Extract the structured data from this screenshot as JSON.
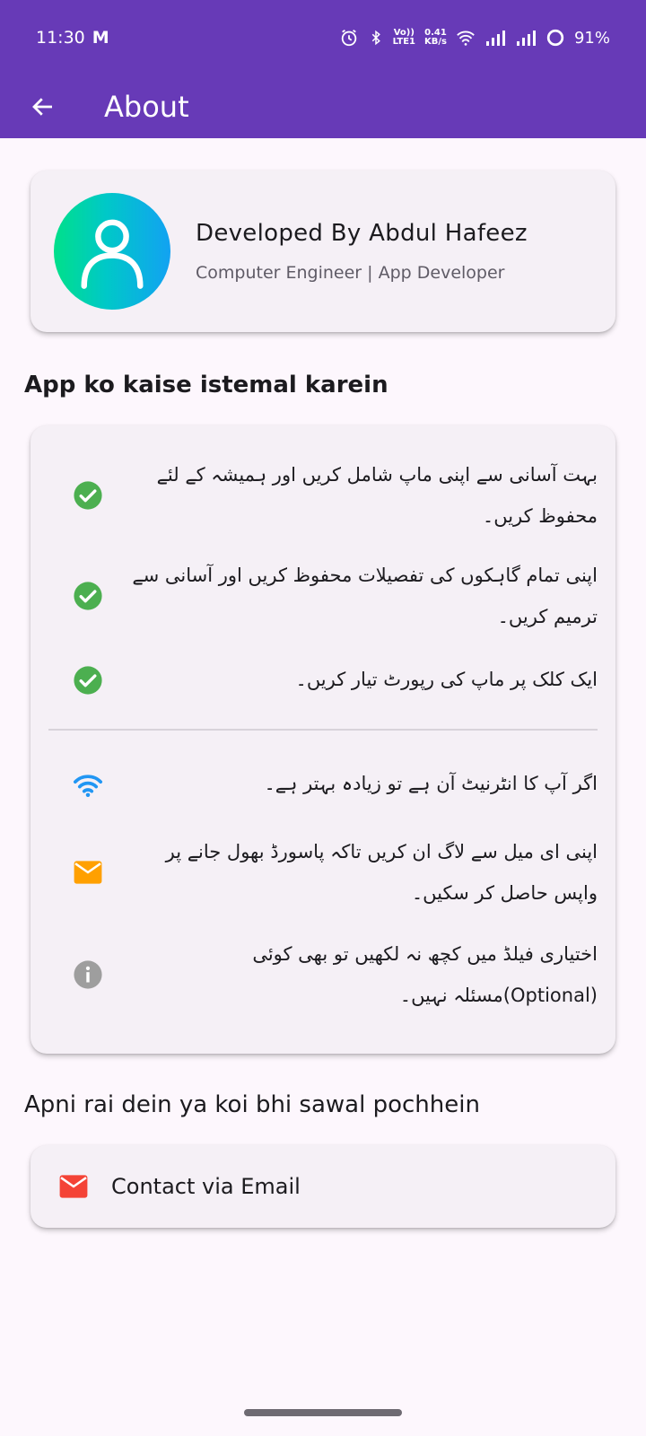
{
  "status_bar": {
    "time": "11:30",
    "mail_indicator": "M",
    "network_speed_value": "0.41",
    "network_speed_unit": "KB/s",
    "lte_top": "Vo))",
    "lte_bottom": "LTE1",
    "battery": "91%"
  },
  "app_bar": {
    "title": "About"
  },
  "developer": {
    "name": "Developed By Abdul Hafeez",
    "role": "Computer Engineer | App Developer"
  },
  "how_to_use": {
    "title": "App ko kaise istemal karein",
    "features": [
      {
        "icon": "check-circle-icon",
        "text": "بہت آسانی سے اپنی ماپ شامل کریں اور ہمیشہ کے لئے محفوظ کریں۔"
      },
      {
        "icon": "check-circle-icon",
        "text": "اپنی تمام گاہکوں کی تفصیلات محفوظ کریں اور آسانی سے ترمیم کریں۔"
      },
      {
        "icon": "check-circle-icon",
        "text": "ایک کلک پر ماپ کی رپورٹ تیار کریں۔"
      }
    ],
    "tips": [
      {
        "icon": "wifi-icon",
        "text": "اگر آپ کا انٹرنیٹ آن ہے تو زیادہ بہتر ہے۔"
      },
      {
        "icon": "email-icon",
        "text": "اپنی ای میل سے لاگ ان کریں تاکہ پاسورڈ بھول جانے پر واپس حاصل کر سکیں۔"
      },
      {
        "icon": "info-icon",
        "text": "اختیاری فیلڈ میں کچھ نہ لکھیں تو بھی کوئی (Optional)مسئلہ نہیں۔"
      }
    ]
  },
  "feedback": {
    "title": "Apni rai dein ya koi bhi sawal pochhein",
    "contact_label": "Contact via Email"
  },
  "colors": {
    "primary": "#673ab7",
    "check": "#4caf50",
    "wifi": "#2196f3",
    "email_tip": "#ffa000",
    "info": "#9e9e9e",
    "contact_email": "#f44336"
  }
}
